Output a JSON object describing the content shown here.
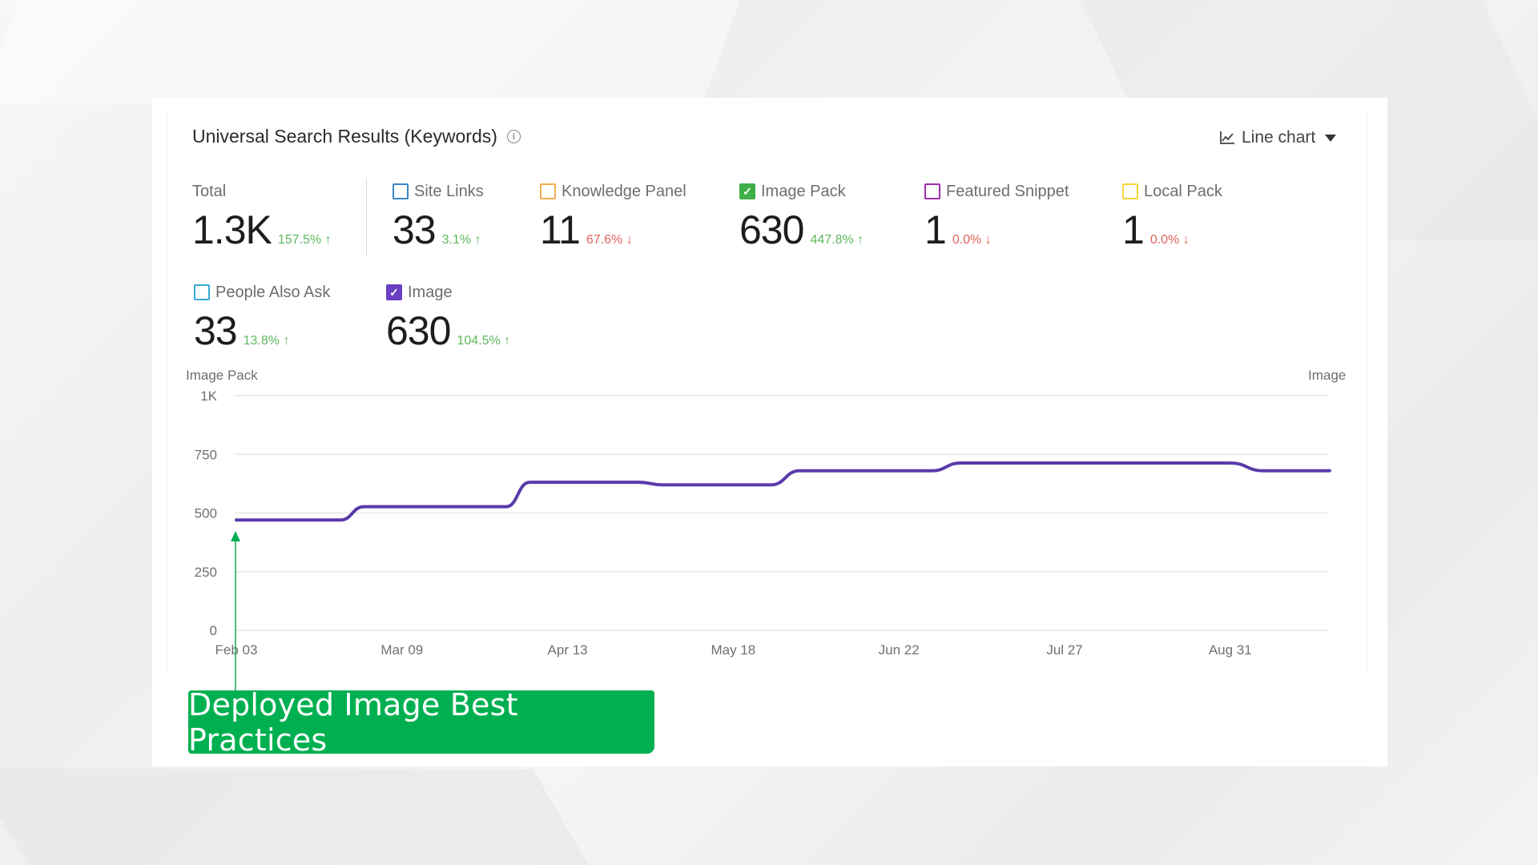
{
  "widget": {
    "title": "Universal Search Results (Keywords)",
    "info_icon": "info-icon",
    "chart_type_icon": "line-chart-icon",
    "chart_type_label": "Line chart",
    "chart_type_caret": "caret-down-icon"
  },
  "metrics": {
    "total": {
      "label": "Total",
      "value": "1.3K",
      "change": "157.5%",
      "direction": "up",
      "arrow": "↑"
    },
    "site_links": {
      "label": "Site Links",
      "value": "33",
      "change": "3.1%",
      "direction": "up",
      "arrow": "↑",
      "checked": false,
      "color": "#3a87c8"
    },
    "knowledge_panel": {
      "label": "Knowledge Panel",
      "value": "11",
      "change": "67.6%",
      "direction": "down",
      "arrow": "↓",
      "checked": false,
      "color": "#f0ad4e"
    },
    "image_pack": {
      "label": "Image Pack",
      "value": "630",
      "change": "447.8%",
      "direction": "up",
      "arrow": "↑",
      "checked": true,
      "color": "#3fae49"
    },
    "featured_snippet": {
      "label": "Featured Snippet",
      "value": "1",
      "change": "0.0%",
      "direction": "down",
      "arrow": "↓",
      "checked": false,
      "color": "#9b30a8"
    },
    "local_pack": {
      "label": "Local Pack",
      "value": "1",
      "change": "0.0%",
      "direction": "down",
      "arrow": "↓",
      "checked": false,
      "color": "#f2d33b"
    },
    "people_also_ask": {
      "label": "People Also Ask",
      "value": "33",
      "change": "13.8%",
      "direction": "up",
      "arrow": "↑",
      "checked": false,
      "color": "#36a9d8"
    },
    "image": {
      "label": "Image",
      "value": "630",
      "change": "104.5%",
      "direction": "up",
      "arrow": "↑",
      "checked": true,
      "color": "#6a3fc1"
    }
  },
  "checkmark": "✓",
  "annotation": {
    "text": "Deployed Image Best Practices",
    "color": "#00b050",
    "date_index": 0
  },
  "chart_data": {
    "type": "line",
    "title": "",
    "left_axis_label": "Image Pack",
    "right_axis_label": "Image",
    "ylim": [
      0,
      1000
    ],
    "yticks": [
      0,
      250,
      500,
      750,
      1000
    ],
    "ytick_labels": [
      "0",
      "250",
      "500",
      "750",
      "1K"
    ],
    "x_tick_labels": [
      "Feb 03",
      "Mar 09",
      "Apr 13",
      "May 18",
      "Jun 22",
      "Jul 27",
      "Aug 31"
    ],
    "x_tick_days": [
      0,
      35,
      70,
      105,
      140,
      175,
      210
    ],
    "x_range_days": [
      0,
      231
    ],
    "grid": true,
    "legend": "none",
    "series": [
      {
        "name": "Image",
        "color": "#5a3aa8",
        "days": [
          0,
          22,
          27,
          57,
          62,
          85,
          90,
          113,
          119,
          147,
          153,
          210,
          217,
          231
        ],
        "values": [
          470,
          470,
          527,
          527,
          631,
          631,
          620,
          620,
          680,
          680,
          713,
          713,
          680,
          680
        ]
      }
    ]
  }
}
